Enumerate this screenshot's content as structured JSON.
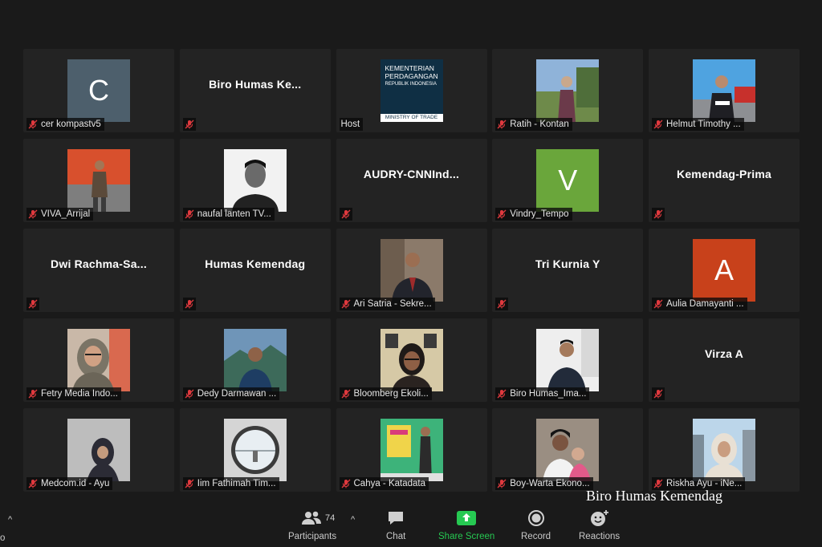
{
  "colors": {
    "tile_bg": "#232323",
    "page_bg": "#1a1a1a",
    "muted_red": "#e0393e",
    "share_green": "#26c952"
  },
  "tiles": [
    {
      "label": "cer kompastv5",
      "muted": true,
      "type": "avatar",
      "initial": "C",
      "avatar_color": "#4d5f6c"
    },
    {
      "label": "",
      "muted": true,
      "type": "name",
      "center_name": "Biro  Humas  Ke..."
    },
    {
      "label": "Host",
      "muted": false,
      "type": "logo",
      "logo_text": [
        "KEMENTERIAN",
        "PERDAGANGAN",
        "REPUBLIK INDONESIA",
        "MINISTRY OF TRADE"
      ]
    },
    {
      "label": "Ratih - Kontan",
      "muted": true,
      "type": "photo",
      "photo": "outdoor-woman"
    },
    {
      "label": "Helmut Timothy ...",
      "muted": true,
      "type": "photo",
      "photo": "man-sky"
    },
    {
      "label": "VIVA_Arrijal",
      "muted": true,
      "type": "photo",
      "photo": "man-wall"
    },
    {
      "label": "naufal lanten TV...",
      "muted": true,
      "type": "photo",
      "photo": "bw-portrait"
    },
    {
      "label": "",
      "muted": true,
      "type": "name",
      "center_name": "AUDRY-CNNInd..."
    },
    {
      "label": "Vindry_Tempo",
      "muted": true,
      "type": "avatar",
      "initial": "V",
      "avatar_color": "#6aa63b"
    },
    {
      "label": "",
      "muted": true,
      "type": "name",
      "center_name": "Kemendag-Prima"
    },
    {
      "label": "",
      "muted": true,
      "type": "name",
      "center_name": "Dwi  Rachma-Sa..."
    },
    {
      "label": "",
      "muted": true,
      "type": "name",
      "center_name": "Humas Kemendag"
    },
    {
      "label": "Ari Satria - Sekre...",
      "muted": true,
      "type": "photo",
      "photo": "man-suit"
    },
    {
      "label": "",
      "muted": true,
      "type": "name",
      "center_name": "Tri Kurnia Y"
    },
    {
      "label": "Aulia Damayanti ...",
      "muted": true,
      "type": "avatar",
      "initial": "A",
      "avatar_color": "#c8411b"
    },
    {
      "label": "Fetry Media Indo...",
      "muted": true,
      "type": "photo",
      "photo": "hijab-glasses"
    },
    {
      "label": "Dedy Darmawan ...",
      "muted": true,
      "type": "photo",
      "photo": "man-mountain"
    },
    {
      "label": "Bloomberg Ekoli...",
      "muted": true,
      "type": "photo",
      "photo": "woman-glasses"
    },
    {
      "label": "Biro Humas_Ima...",
      "muted": true,
      "type": "photo",
      "photo": "man-office"
    },
    {
      "label": "",
      "muted": true,
      "type": "name",
      "center_name": "Virza A"
    },
    {
      "label": "Medcom.id - Ayu",
      "muted": true,
      "type": "photo",
      "photo": "hijab-wall"
    },
    {
      "label": "Iim Fathimah Tim...",
      "muted": true,
      "type": "photo",
      "photo": "circle-window"
    },
    {
      "label": "Cahya - Katadata",
      "muted": true,
      "type": "photo",
      "photo": "green-backdrop"
    },
    {
      "label": "Boy-Warta Ekono...",
      "muted": true,
      "type": "photo",
      "photo": "family"
    },
    {
      "label": "Riskha Ayu - iNe...",
      "muted": true,
      "type": "photo",
      "photo": "hijab-city"
    }
  ],
  "toolbar": {
    "participants_label": "Participants",
    "participants_count": "74",
    "chat_label": "Chat",
    "share_label": "Share Screen",
    "record_label": "Record",
    "reactions_label": "Reactions",
    "caret": "^",
    "edge_label": "o"
  },
  "watermark": "Biro Humas Kemendag"
}
